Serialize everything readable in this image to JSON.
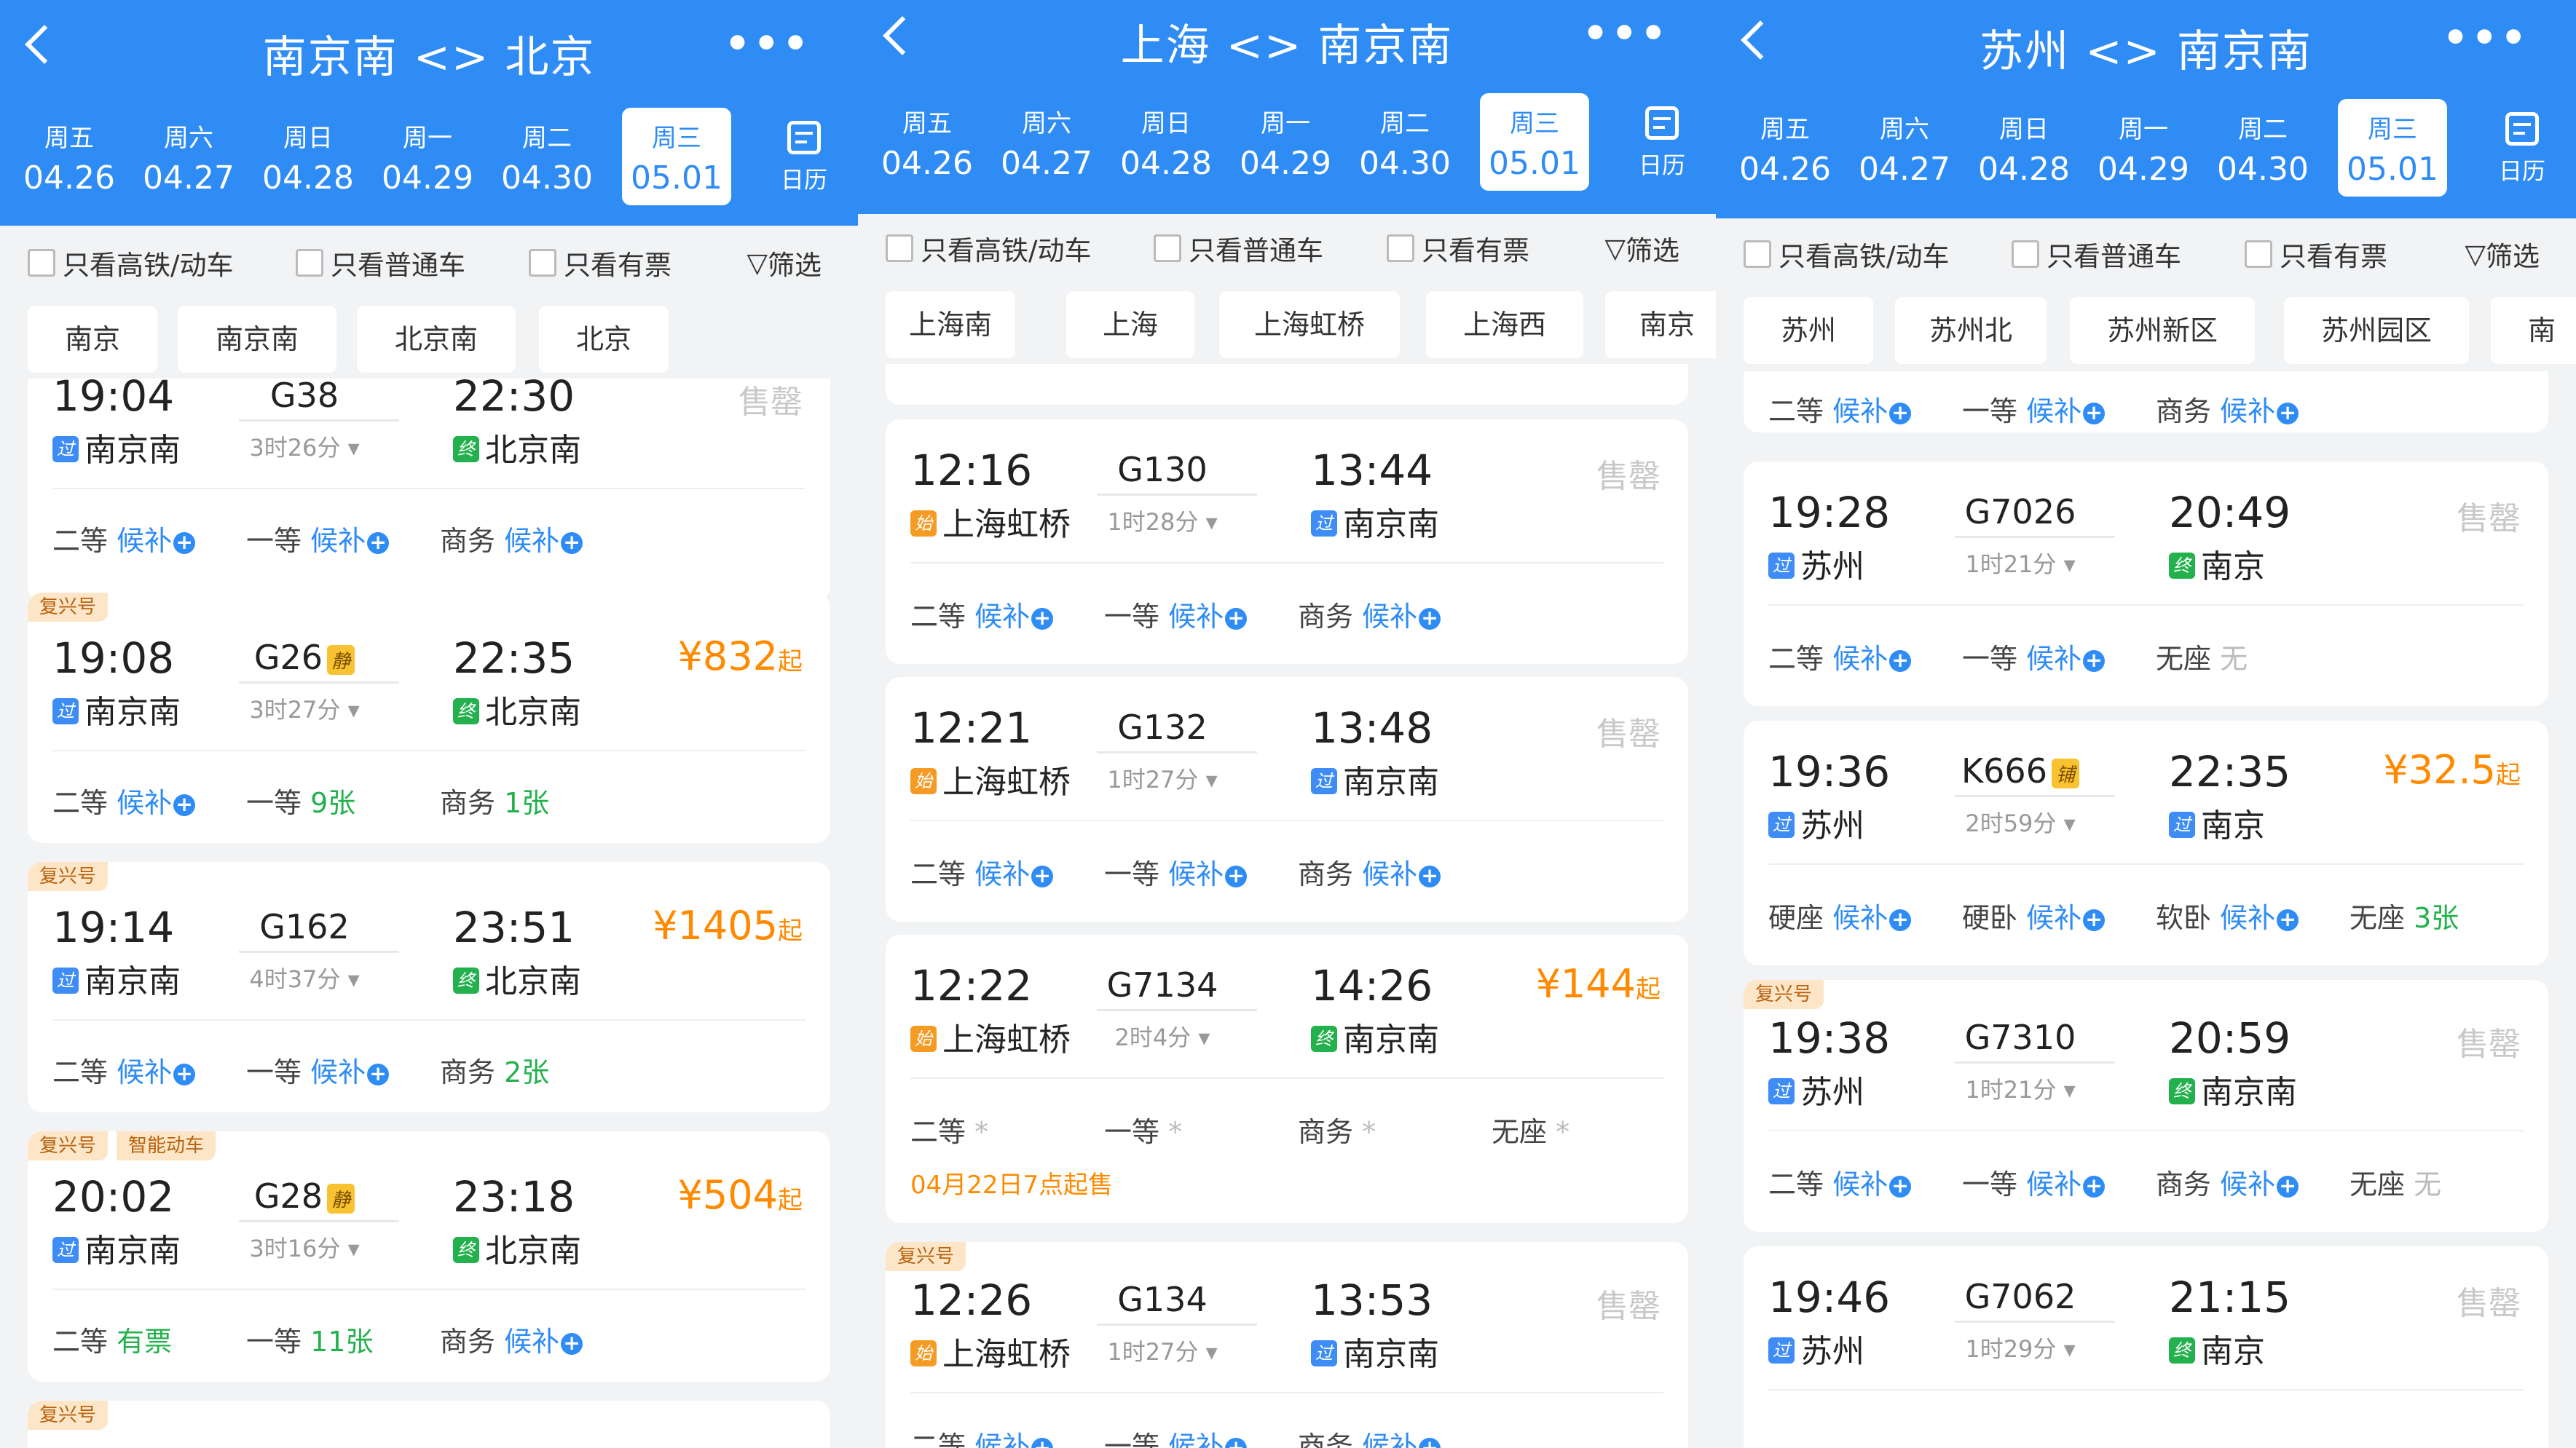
{
  "screens": [
    {
      "title": "南京南 <> 北京",
      "dates": [
        {
          "dow": "周五",
          "md": "04.26"
        },
        {
          "dow": "周六",
          "md": "04.27"
        },
        {
          "dow": "周日",
          "md": "04.28"
        },
        {
          "dow": "周一",
          "md": "04.29"
        },
        {
          "dow": "周二",
          "md": "04.30"
        },
        {
          "dow": "周三",
          "md": "05.01"
        }
      ],
      "selected_date_index": 5,
      "calendar_label": "日历",
      "filters": [
        "只看高铁/动车",
        "只看普通车",
        "只看有票"
      ],
      "filter_button": "筛选",
      "stations": [
        "南京",
        "南京南",
        "北京南",
        "北京"
      ],
      "trains": [
        {
          "tags": [],
          "dep": "19:04",
          "no": "G38",
          "badge": "",
          "arr": "22:30",
          "dur": "3时26分",
          "from_mark": "过",
          "from": "南京南",
          "to_mark": "终",
          "to": "北京南",
          "price": "",
          "price_suffix": "",
          "status": "售罄",
          "seats": [
            {
              "cls": "二等",
              "val": "候补",
              "plus": true,
              "color": "blue"
            },
            {
              "cls": "一等",
              "val": "候补",
              "plus": true,
              "color": "blue"
            },
            {
              "cls": "商务",
              "val": "候补",
              "plus": true,
              "color": "blue"
            }
          ],
          "note": ""
        },
        {
          "tags": [
            "复兴号"
          ],
          "dep": "19:08",
          "no": "G26",
          "badge": "静",
          "arr": "22:35",
          "dur": "3时27分",
          "from_mark": "过",
          "from": "南京南",
          "to_mark": "终",
          "to": "北京南",
          "price": "¥832",
          "price_suffix": "起",
          "status": "",
          "seats": [
            {
              "cls": "二等",
              "val": "候补",
              "plus": true,
              "color": "blue"
            },
            {
              "cls": "一等",
              "val": "9张",
              "plus": false,
              "color": "green"
            },
            {
              "cls": "商务",
              "val": "1张",
              "plus": false,
              "color": "green"
            }
          ],
          "note": ""
        },
        {
          "tags": [
            "复兴号"
          ],
          "dep": "19:14",
          "no": "G162",
          "badge": "",
          "arr": "23:51",
          "dur": "4时37分",
          "from_mark": "过",
          "from": "南京南",
          "to_mark": "终",
          "to": "北京南",
          "price": "¥1405",
          "price_suffix": "起",
          "status": "",
          "seats": [
            {
              "cls": "二等",
              "val": "候补",
              "plus": true,
              "color": "blue"
            },
            {
              "cls": "一等",
              "val": "候补",
              "plus": true,
              "color": "blue"
            },
            {
              "cls": "商务",
              "val": "2张",
              "plus": false,
              "color": "green"
            }
          ],
          "note": ""
        },
        {
          "tags": [
            "复兴号",
            "智能动车"
          ],
          "dep": "20:02",
          "no": "G28",
          "badge": "静",
          "arr": "23:18",
          "dur": "3时16分",
          "from_mark": "过",
          "from": "南京南",
          "to_mark": "终",
          "to": "北京南",
          "price": "¥504",
          "price_suffix": "起",
          "status": "",
          "seats": [
            {
              "cls": "二等",
              "val": "有票",
              "plus": false,
              "color": "green"
            },
            {
              "cls": "一等",
              "val": "11张",
              "plus": false,
              "color": "green"
            },
            {
              "cls": "商务",
              "val": "候补",
              "plus": true,
              "color": "blue"
            }
          ],
          "note": ""
        },
        {
          "tags": [
            "复兴号"
          ],
          "dep": "",
          "no": "",
          "badge": "",
          "arr": "",
          "dur": "",
          "from_mark": "",
          "from": "",
          "to_mark": "",
          "to": "",
          "price": "",
          "price_suffix": "",
          "status": "",
          "seats": [],
          "note": ""
        }
      ]
    },
    {
      "title": "上海 <> 南京南",
      "dates": [
        {
          "dow": "周五",
          "md": "04.26"
        },
        {
          "dow": "周六",
          "md": "04.27"
        },
        {
          "dow": "周日",
          "md": "04.28"
        },
        {
          "dow": "周一",
          "md": "04.29"
        },
        {
          "dow": "周二",
          "md": "04.30"
        },
        {
          "dow": "周三",
          "md": "05.01"
        }
      ],
      "selected_date_index": 5,
      "calendar_label": "日历",
      "filters": [
        "只看高铁/动车",
        "只看普通车",
        "只看有票"
      ],
      "filter_button": "筛选",
      "stations": [
        "上海南",
        "上海",
        "上海虹桥",
        "上海西",
        "南京"
      ],
      "trains": [
        {
          "tags": [],
          "dep": "12:16",
          "no": "G130",
          "badge": "",
          "arr": "13:44",
          "dur": "1时28分",
          "from_mark": "始",
          "from": "上海虹桥",
          "to_mark": "过",
          "to": "南京南",
          "price": "",
          "price_suffix": "",
          "status": "售罄",
          "seats": [
            {
              "cls": "二等",
              "val": "候补",
              "plus": true,
              "color": "blue"
            },
            {
              "cls": "一等",
              "val": "候补",
              "plus": true,
              "color": "blue"
            },
            {
              "cls": "商务",
              "val": "候补",
              "plus": true,
              "color": "blue"
            }
          ],
          "note": ""
        },
        {
          "tags": [],
          "dep": "12:21",
          "no": "G132",
          "badge": "",
          "arr": "13:48",
          "dur": "1时27分",
          "from_mark": "始",
          "from": "上海虹桥",
          "to_mark": "过",
          "to": "南京南",
          "price": "",
          "price_suffix": "",
          "status": "售罄",
          "seats": [
            {
              "cls": "二等",
              "val": "候补",
              "plus": true,
              "color": "blue"
            },
            {
              "cls": "一等",
              "val": "候补",
              "plus": true,
              "color": "blue"
            },
            {
              "cls": "商务",
              "val": "候补",
              "plus": true,
              "color": "blue"
            }
          ],
          "note": ""
        },
        {
          "tags": [],
          "dep": "12:22",
          "no": "G7134",
          "badge": "",
          "arr": "14:26",
          "dur": "2时4分",
          "from_mark": "始",
          "from": "上海虹桥",
          "to_mark": "终",
          "to": "南京南",
          "price": "¥144",
          "price_suffix": "起",
          "status": "",
          "seats": [
            {
              "cls": "二等",
              "val": "*",
              "plus": false,
              "color": "gray"
            },
            {
              "cls": "一等",
              "val": "*",
              "plus": false,
              "color": "gray"
            },
            {
              "cls": "商务",
              "val": "*",
              "plus": false,
              "color": "gray"
            },
            {
              "cls": "无座",
              "val": "*",
              "plus": false,
              "color": "gray"
            }
          ],
          "note": "04月22日7点起售"
        },
        {
          "tags": [
            "复兴号"
          ],
          "dep": "12:26",
          "no": "G134",
          "badge": "",
          "arr": "13:53",
          "dur": "1时27分",
          "from_mark": "始",
          "from": "上海虹桥",
          "to_mark": "过",
          "to": "南京南",
          "price": "",
          "price_suffix": "",
          "status": "售罄",
          "seats": [
            {
              "cls": "二等",
              "val": "候补",
              "plus": true,
              "color": "blue"
            },
            {
              "cls": "一等",
              "val": "候补",
              "plus": true,
              "color": "blue"
            },
            {
              "cls": "商务",
              "val": "候补",
              "plus": true,
              "color": "blue"
            }
          ],
          "note": ""
        }
      ]
    },
    {
      "title": "苏州 <> 南京南",
      "dates": [
        {
          "dow": "周五",
          "md": "04.26"
        },
        {
          "dow": "周六",
          "md": "04.27"
        },
        {
          "dow": "周日",
          "md": "04.28"
        },
        {
          "dow": "周一",
          "md": "04.29"
        },
        {
          "dow": "周二",
          "md": "04.30"
        },
        {
          "dow": "周三",
          "md": "05.01"
        }
      ],
      "selected_date_index": 5,
      "calendar_label": "日历",
      "filters": [
        "只看高铁/动车",
        "只看普通车",
        "只看有票"
      ],
      "filter_button": "筛选",
      "stations": [
        "苏州",
        "苏州北",
        "苏州新区",
        "苏州园区",
        "南"
      ],
      "trains": [
        {
          "tags": [],
          "dep": "",
          "no": "",
          "badge": "",
          "arr": "",
          "dur": "",
          "from_mark": "",
          "from": "",
          "to_mark": "",
          "to": "",
          "price": "",
          "price_suffix": "",
          "status": "",
          "seats": [
            {
              "cls": "二等",
              "val": "候补",
              "plus": true,
              "color": "blue"
            },
            {
              "cls": "一等",
              "val": "候补",
              "plus": true,
              "color": "blue"
            },
            {
              "cls": "商务",
              "val": "候补",
              "plus": true,
              "color": "blue"
            }
          ],
          "note": ""
        },
        {
          "tags": [],
          "dep": "19:28",
          "no": "G7026",
          "badge": "",
          "arr": "20:49",
          "dur": "1时21分",
          "from_mark": "过",
          "from": "苏州",
          "to_mark": "终",
          "to": "南京",
          "price": "",
          "price_suffix": "",
          "status": "售罄",
          "seats": [
            {
              "cls": "二等",
              "val": "候补",
              "plus": true,
              "color": "blue"
            },
            {
              "cls": "一等",
              "val": "候补",
              "plus": true,
              "color": "blue"
            },
            {
              "cls": "无座",
              "val": "无",
              "plus": false,
              "color": "gray"
            }
          ],
          "note": ""
        },
        {
          "tags": [],
          "dep": "19:36",
          "no": "K666",
          "badge": "铺",
          "arr": "22:35",
          "dur": "2时59分",
          "from_mark": "过",
          "from": "苏州",
          "to_mark": "过",
          "to": "南京",
          "price": "¥32.5",
          "price_suffix": "起",
          "status": "",
          "seats": [
            {
              "cls": "硬座",
              "val": "候补",
              "plus": true,
              "color": "blue"
            },
            {
              "cls": "硬卧",
              "val": "候补",
              "plus": true,
              "color": "blue"
            },
            {
              "cls": "软卧",
              "val": "候补",
              "plus": true,
              "color": "blue"
            },
            {
              "cls": "无座",
              "val": "3张",
              "plus": false,
              "color": "green"
            }
          ],
          "note": ""
        },
        {
          "tags": [
            "复兴号"
          ],
          "dep": "19:38",
          "no": "G7310",
          "badge": "",
          "arr": "20:59",
          "dur": "1时21分",
          "from_mark": "过",
          "from": "苏州",
          "to_mark": "终",
          "to": "南京南",
          "price": "",
          "price_suffix": "",
          "status": "售罄",
          "seats": [
            {
              "cls": "二等",
              "val": "候补",
              "plus": true,
              "color": "blue"
            },
            {
              "cls": "一等",
              "val": "候补",
              "plus": true,
              "color": "blue"
            },
            {
              "cls": "商务",
              "val": "候补",
              "plus": true,
              "color": "blue"
            },
            {
              "cls": "无座",
              "val": "无",
              "plus": false,
              "color": "gray"
            }
          ],
          "note": ""
        },
        {
          "tags": [],
          "dep": "19:46",
          "no": "G7062",
          "badge": "",
          "arr": "21:15",
          "dur": "1时29分",
          "from_mark": "过",
          "from": "苏州",
          "to_mark": "终",
          "to": "南京",
          "price": "",
          "price_suffix": "",
          "status": "售罄",
          "seats": [],
          "note": ""
        }
      ]
    }
  ],
  "colors": {
    "brand": "#2f8cf5",
    "price": "#ff8a00",
    "available": "#23b14d",
    "soldout": "#c8c8c8"
  }
}
